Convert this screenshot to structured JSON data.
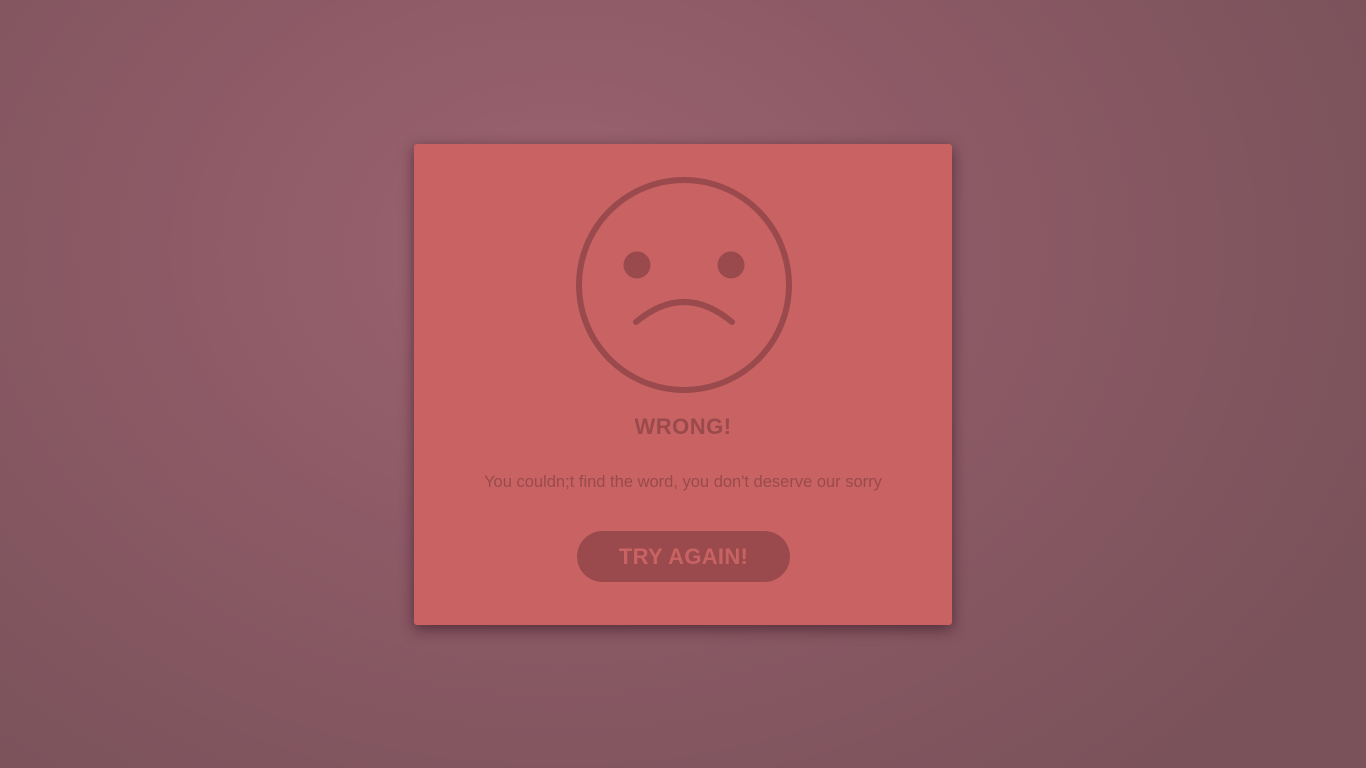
{
  "dialog": {
    "title": "WRONG!",
    "message": "You couldn;t find the word, you don't deserve our sorry",
    "button_label": "TRY AGAIN!",
    "icon": "sad-face-icon"
  },
  "colors": {
    "background": "#8c5a66",
    "card": "#c96363",
    "accent": "#9a4a4c"
  }
}
